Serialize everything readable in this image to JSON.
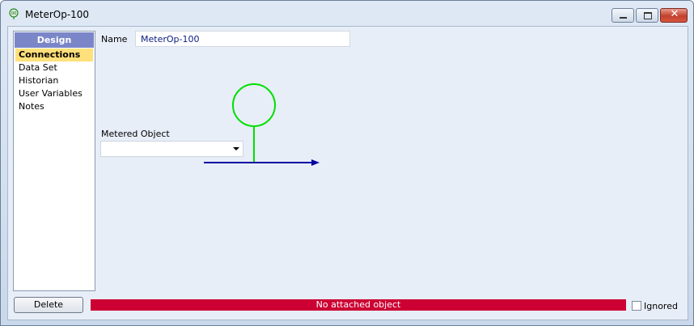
{
  "window": {
    "title": "MeterOp-100",
    "icon": "meter-icon",
    "buttons": [
      "minimize-icon",
      "maximize-icon",
      "close-icon"
    ]
  },
  "sidebar": {
    "header": "Design",
    "items": [
      {
        "label": "Connections",
        "active": true
      },
      {
        "label": "Data Set"
      },
      {
        "label": "Historian"
      },
      {
        "label": "User Variables"
      },
      {
        "label": "Notes"
      }
    ]
  },
  "form": {
    "name_label": "Name",
    "name_value": "MeterOp-100",
    "metered_label": "Metered Object",
    "metered_value": ""
  },
  "diagram": {
    "circle_color": "#00e000",
    "line_color": "#0000a0"
  },
  "footer": {
    "delete_label": "Delete",
    "status_text": "No attached object",
    "status_color": "#cc0033",
    "ignored_label": "Ignored",
    "ignored_checked": false
  }
}
